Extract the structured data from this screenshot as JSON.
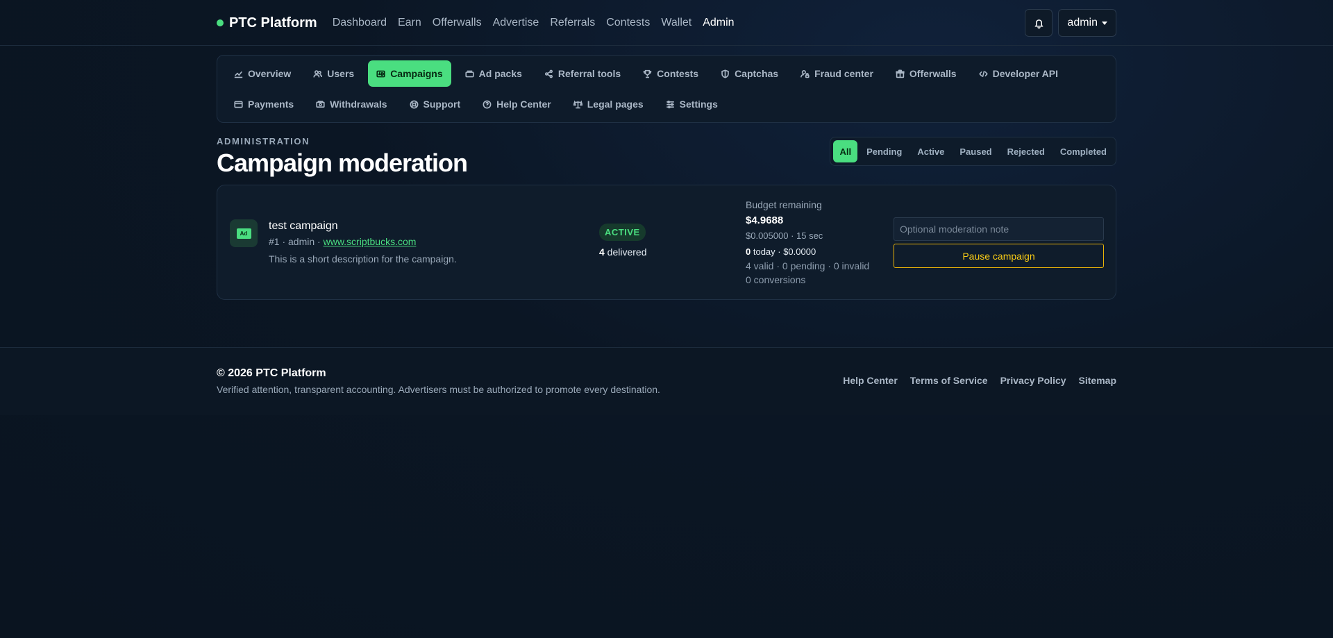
{
  "navbar": {
    "brand": "PTC Platform",
    "links": [
      "Dashboard",
      "Earn",
      "Offerwalls",
      "Advertise",
      "Referrals",
      "Contests",
      "Wallet",
      "Admin"
    ],
    "active_link": "Admin",
    "user": "admin"
  },
  "admin_tabs": {
    "row1": [
      {
        "label": "Overview",
        "icon": "chart-line-icon"
      },
      {
        "label": "Users",
        "icon": "users-icon"
      },
      {
        "label": "Campaigns",
        "icon": "ad-icon"
      },
      {
        "label": "Ad packs",
        "icon": "layers-icon"
      },
      {
        "label": "Referral tools",
        "icon": "share-icon"
      },
      {
        "label": "Contests",
        "icon": "trophy-icon"
      },
      {
        "label": "Captchas",
        "icon": "shield-icon"
      },
      {
        "label": "Fraud center",
        "icon": "user-lock-icon"
      },
      {
        "label": "Offerwalls",
        "icon": "gift-icon"
      },
      {
        "label": "Developer API",
        "icon": "code-icon"
      }
    ],
    "row2": [
      {
        "label": "Payments",
        "icon": "wallet-icon"
      },
      {
        "label": "Withdrawals",
        "icon": "money-icon"
      },
      {
        "label": "Support",
        "icon": "life-ring-icon"
      },
      {
        "label": "Help Center",
        "icon": "question-icon"
      },
      {
        "label": "Legal pages",
        "icon": "scale-icon"
      },
      {
        "label": "Settings",
        "icon": "sliders-icon"
      }
    ],
    "active": "Campaigns"
  },
  "page": {
    "eyebrow": "ADMINISTRATION",
    "title": "Campaign moderation",
    "filters": [
      "All",
      "Pending",
      "Active",
      "Paused",
      "Rejected",
      "Completed"
    ],
    "active_filter": "All"
  },
  "campaign": {
    "icon_label": "Ad",
    "title": "test campaign",
    "meta_prefix": "#1 · admin · ",
    "url": "www.scriptbucks.com",
    "description": "This is a short description for the campaign.",
    "status": "ACTIVE",
    "delivered_count": "4",
    "delivered_label": " delivered",
    "budget_label": "Budget remaining",
    "budget_value": "$4.9688",
    "rate_line": "$0.005000 · 15 sec",
    "today_count": "0",
    "today_rest": " today · $0.0000",
    "validity_line": "4 valid · 0 pending · 0 invalid",
    "conversions_line": "0 conversions",
    "note_placeholder": "Optional moderation note",
    "pause_label": "Pause campaign"
  },
  "footer": {
    "title": "© 2026 PTC Platform",
    "subtitle": "Verified attention, transparent accounting. Advertisers must be authorized to promote every destination.",
    "links": [
      "Help Center",
      "Terms of Service",
      "Privacy Policy",
      "Sitemap"
    ]
  },
  "colors": {
    "accent": "#4ade80",
    "background": "#0b1624",
    "warning": "#facc15"
  }
}
